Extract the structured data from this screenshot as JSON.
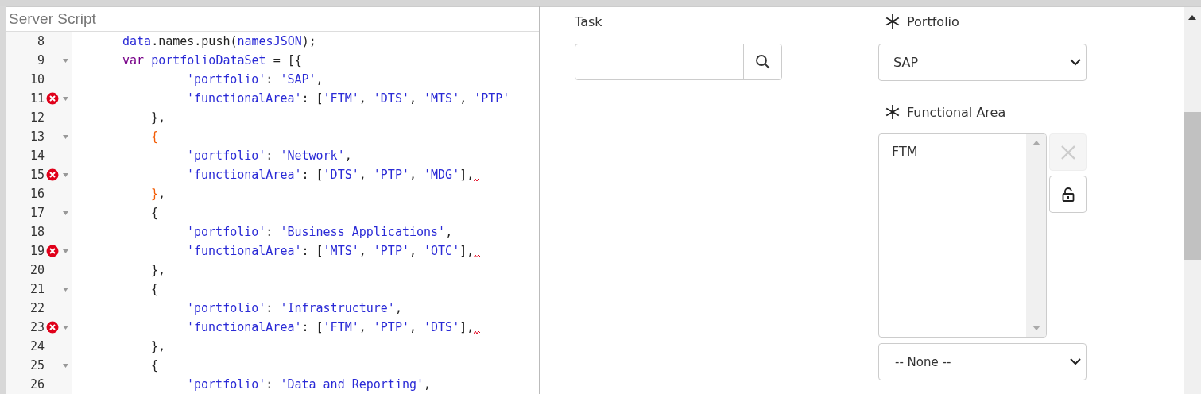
{
  "editor": {
    "title": "Server Script",
    "lines": [
      {
        "number": "8",
        "kind": "statement",
        "fold": false,
        "error": false,
        "squiggle": false,
        "tokens": [
          {
            "kind": "ident",
            "text": "data"
          },
          {
            "kind": "plain",
            "text": ".names.push("
          },
          {
            "kind": "ident",
            "text": "namesJSON"
          },
          {
            "kind": "plain",
            "text": ");"
          }
        ]
      },
      {
        "number": "9",
        "kind": "statement",
        "fold": true,
        "error": false,
        "squiggle": false,
        "tokens": [
          {
            "kind": "keyword",
            "text": "var"
          },
          {
            "kind": "ident",
            "text": "portfolioDataSet"
          },
          {
            "kind": "plain",
            "text": "= [{"
          }
        ]
      },
      {
        "number": "10",
        "kind": "property",
        "fold": false,
        "error": false,
        "squiggle": false,
        "tokens": [
          {
            "kind": "string",
            "text": "'portfolio'"
          },
          {
            "kind": "plain",
            "text": ":"
          },
          {
            "kind": "string",
            "text": "'SAP'"
          },
          {
            "kind": "plain",
            "text": ","
          }
        ]
      },
      {
        "number": "11",
        "kind": "property",
        "fold": true,
        "error": true,
        "squiggle": false,
        "tokens": [
          {
            "kind": "string",
            "text": "'functionalArea'"
          },
          {
            "kind": "plain",
            "text": ": ["
          },
          {
            "kind": "string",
            "text": "'FTM'"
          },
          {
            "kind": "plain",
            "text": ","
          },
          {
            "kind": "string",
            "text": "'DTS'"
          },
          {
            "kind": "plain",
            "text": ","
          },
          {
            "kind": "string",
            "text": "'MTS'"
          },
          {
            "kind": "plain",
            "text": ","
          },
          {
            "kind": "string",
            "text": "'PTP'"
          }
        ]
      },
      {
        "number": "12",
        "kind": "brace",
        "fold": false,
        "error": false,
        "squiggle": false,
        "tokens": [
          {
            "kind": "plain",
            "text": "},"
          }
        ]
      },
      {
        "number": "13",
        "kind": "brace",
        "fold": true,
        "error": false,
        "squiggle": false,
        "tokens": [
          {
            "kind": "bracket",
            "text": "{"
          }
        ]
      },
      {
        "number": "14",
        "kind": "property",
        "fold": false,
        "error": false,
        "squiggle": false,
        "tokens": [
          {
            "kind": "string",
            "text": "'portfolio'"
          },
          {
            "kind": "plain",
            "text": ":"
          },
          {
            "kind": "string",
            "text": "'Network'"
          },
          {
            "kind": "plain",
            "text": ","
          }
        ]
      },
      {
        "number": "15",
        "kind": "property",
        "fold": true,
        "error": true,
        "squiggle": true,
        "tokens": [
          {
            "kind": "string",
            "text": "'functionalArea'"
          },
          {
            "kind": "plain",
            "text": ": ["
          },
          {
            "kind": "string",
            "text": "'DTS'"
          },
          {
            "kind": "plain",
            "text": ","
          },
          {
            "kind": "string",
            "text": "'PTP'"
          },
          {
            "kind": "plain",
            "text": ","
          },
          {
            "kind": "string",
            "text": "'MDG'"
          },
          {
            "kind": "plain",
            "text": "],"
          }
        ]
      },
      {
        "number": "16",
        "kind": "brace",
        "fold": false,
        "error": false,
        "squiggle": false,
        "tokens": [
          {
            "kind": "bracket",
            "text": "}"
          },
          {
            "kind": "plain",
            "text": ","
          }
        ]
      },
      {
        "number": "17",
        "kind": "brace",
        "fold": true,
        "error": false,
        "squiggle": false,
        "tokens": [
          {
            "kind": "plain",
            "text": "{"
          }
        ]
      },
      {
        "number": "18",
        "kind": "property",
        "fold": false,
        "error": false,
        "squiggle": false,
        "tokens": [
          {
            "kind": "string",
            "text": "'portfolio'"
          },
          {
            "kind": "plain",
            "text": ":"
          },
          {
            "kind": "string",
            "text": "'Business Applications'"
          },
          {
            "kind": "plain",
            "text": ","
          }
        ]
      },
      {
        "number": "19",
        "kind": "property",
        "fold": true,
        "error": true,
        "squiggle": true,
        "tokens": [
          {
            "kind": "string",
            "text": "'functionalArea'"
          },
          {
            "kind": "plain",
            "text": ": ["
          },
          {
            "kind": "string",
            "text": "'MTS'"
          },
          {
            "kind": "plain",
            "text": ","
          },
          {
            "kind": "string",
            "text": "'PTP'"
          },
          {
            "kind": "plain",
            "text": ","
          },
          {
            "kind": "string",
            "text": "'OTC'"
          },
          {
            "kind": "plain",
            "text": "],"
          }
        ]
      },
      {
        "number": "20",
        "kind": "brace",
        "fold": false,
        "error": false,
        "squiggle": false,
        "tokens": [
          {
            "kind": "plain",
            "text": "},"
          }
        ]
      },
      {
        "number": "21",
        "kind": "brace",
        "fold": true,
        "error": false,
        "squiggle": false,
        "tokens": [
          {
            "kind": "plain",
            "text": "{"
          }
        ]
      },
      {
        "number": "22",
        "kind": "property",
        "fold": false,
        "error": false,
        "squiggle": false,
        "tokens": [
          {
            "kind": "string",
            "text": "'portfolio'"
          },
          {
            "kind": "plain",
            "text": ":"
          },
          {
            "kind": "string",
            "text": "'Infrastructure'"
          },
          {
            "kind": "plain",
            "text": ","
          }
        ]
      },
      {
        "number": "23",
        "kind": "property",
        "fold": true,
        "error": true,
        "squiggle": true,
        "tokens": [
          {
            "kind": "string",
            "text": "'functionalArea'"
          },
          {
            "kind": "plain",
            "text": ": ["
          },
          {
            "kind": "string",
            "text": "'FTM'"
          },
          {
            "kind": "plain",
            "text": ","
          },
          {
            "kind": "string",
            "text": "'PTP'"
          },
          {
            "kind": "plain",
            "text": ","
          },
          {
            "kind": "string",
            "text": "'DTS'"
          },
          {
            "kind": "plain",
            "text": "],"
          }
        ]
      },
      {
        "number": "24",
        "kind": "brace",
        "fold": false,
        "error": false,
        "squiggle": false,
        "tokens": [
          {
            "kind": "plain",
            "text": "},"
          }
        ]
      },
      {
        "number": "25",
        "kind": "brace",
        "fold": true,
        "error": false,
        "squiggle": false,
        "tokens": [
          {
            "kind": "plain",
            "text": "{"
          }
        ]
      },
      {
        "number": "26",
        "kind": "property",
        "fold": false,
        "error": false,
        "squiggle": false,
        "tokens": [
          {
            "kind": "string",
            "text": "'portfolio'"
          },
          {
            "kind": "plain",
            "text": ":"
          },
          {
            "kind": "string",
            "text": "'Data and Reporting'"
          },
          {
            "kind": "plain",
            "text": ","
          }
        ]
      }
    ]
  },
  "form": {
    "task": {
      "label": "Task"
    },
    "portfolio": {
      "label": "Portfolio",
      "required": true,
      "value": "SAP"
    },
    "functional_area": {
      "label": "Functional Area",
      "required": true,
      "items": [
        "FTM"
      ],
      "clear_disabled": true,
      "qualifier": "-- None --"
    }
  }
}
